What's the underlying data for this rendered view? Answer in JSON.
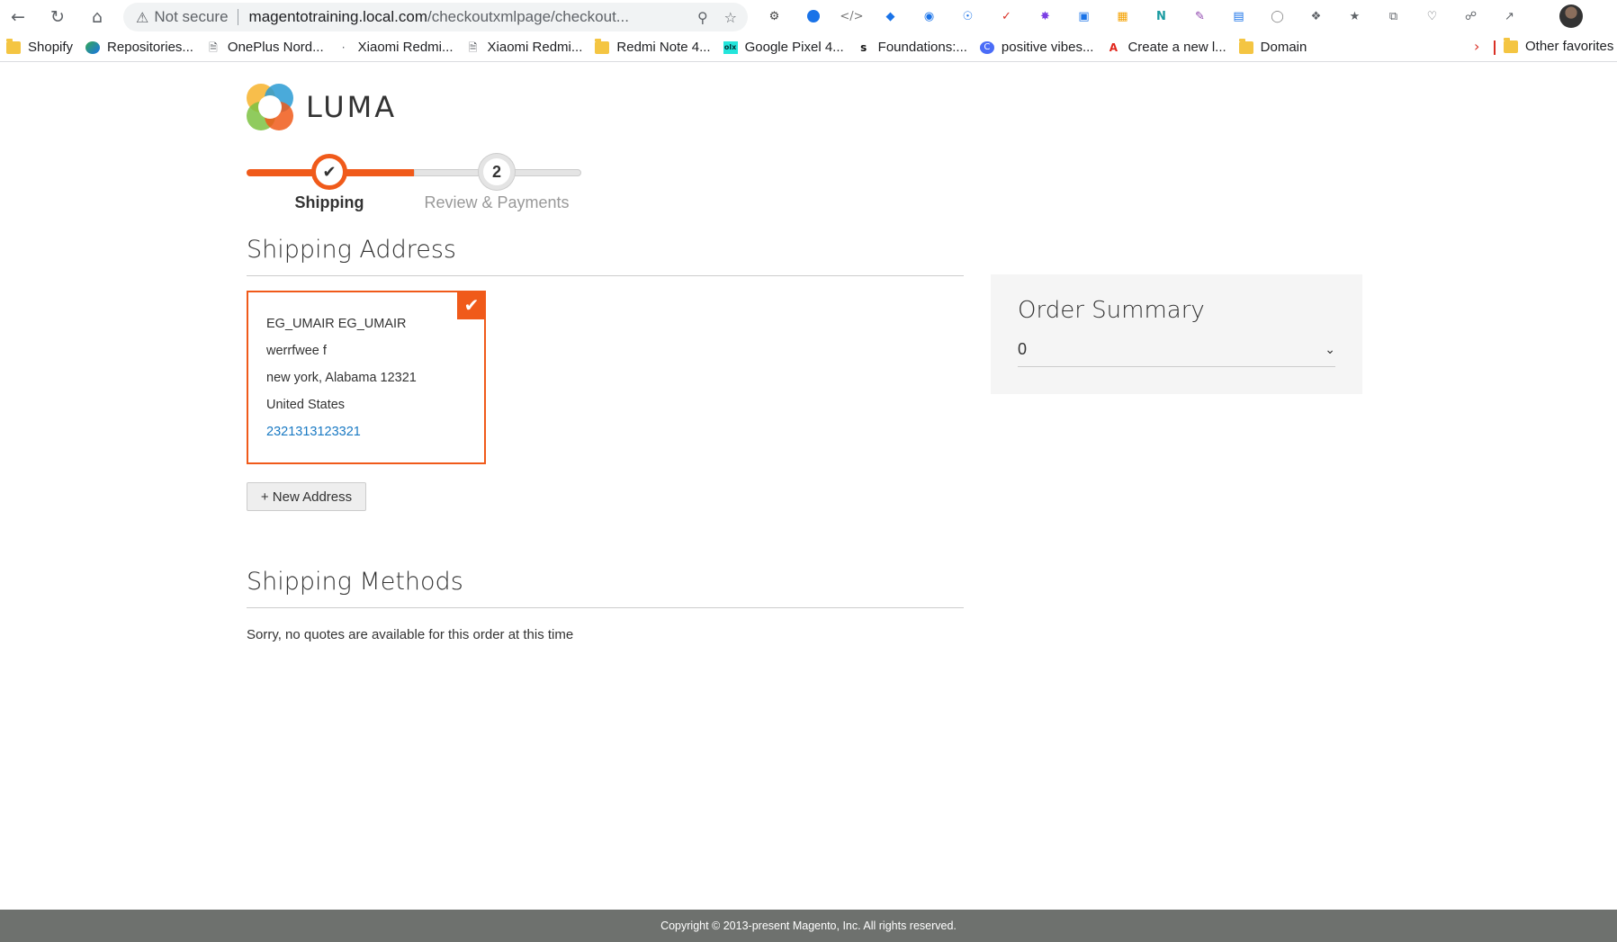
{
  "browser": {
    "not_secure": "Not secure",
    "url_host": "magentotraining.local.com",
    "url_path": "/checkoutxmlpage/checkout...",
    "bookmarks": [
      {
        "label": "Shopify",
        "icon": "folder"
      },
      {
        "label": "Repositories...",
        "icon": "site"
      },
      {
        "label": "OnePlus Nord...",
        "icon": "page"
      },
      {
        "label": "Xiaomi Redmi...",
        "icon": "dot"
      },
      {
        "label": "Xiaomi Redmi...",
        "icon": "page"
      },
      {
        "label": "Redmi Note 4...",
        "icon": "folder"
      },
      {
        "label": "Google Pixel 4...",
        "icon": "olx"
      },
      {
        "label": "Foundations:...",
        "icon": "s"
      },
      {
        "label": "positive vibes...",
        "icon": "c"
      },
      {
        "label": "Create a new l...",
        "icon": "adobe"
      },
      {
        "label": "Domain",
        "icon": "folder"
      }
    ],
    "other_favorites": "Other favorites"
  },
  "logo": {
    "text": "LUMA"
  },
  "progress": {
    "steps": [
      {
        "label": "Shipping",
        "state": "complete"
      },
      {
        "label": "Review & Payments",
        "number": "2",
        "state": "pending"
      }
    ]
  },
  "shipping_address": {
    "title": "Shipping Address",
    "card": {
      "name": "EG_UMAIR EG_UMAIR",
      "street": "werrfwee f",
      "city_line": "new york, Alabama 12321",
      "country": "United States",
      "phone": "2321313123321"
    },
    "new_address_button": "+ New Address"
  },
  "shipping_methods": {
    "title": "Shipping Methods",
    "message": "Sorry, no quotes are available for this order at this time"
  },
  "order_summary": {
    "title": "Order Summary",
    "items_count": "0"
  },
  "footer": {
    "copyright": "Copyright © 2013-present Magento, Inc. All rights reserved."
  },
  "colors": {
    "accent": "#f05a1a",
    "link": "#1979c3",
    "footer_bg": "#6e716e"
  }
}
